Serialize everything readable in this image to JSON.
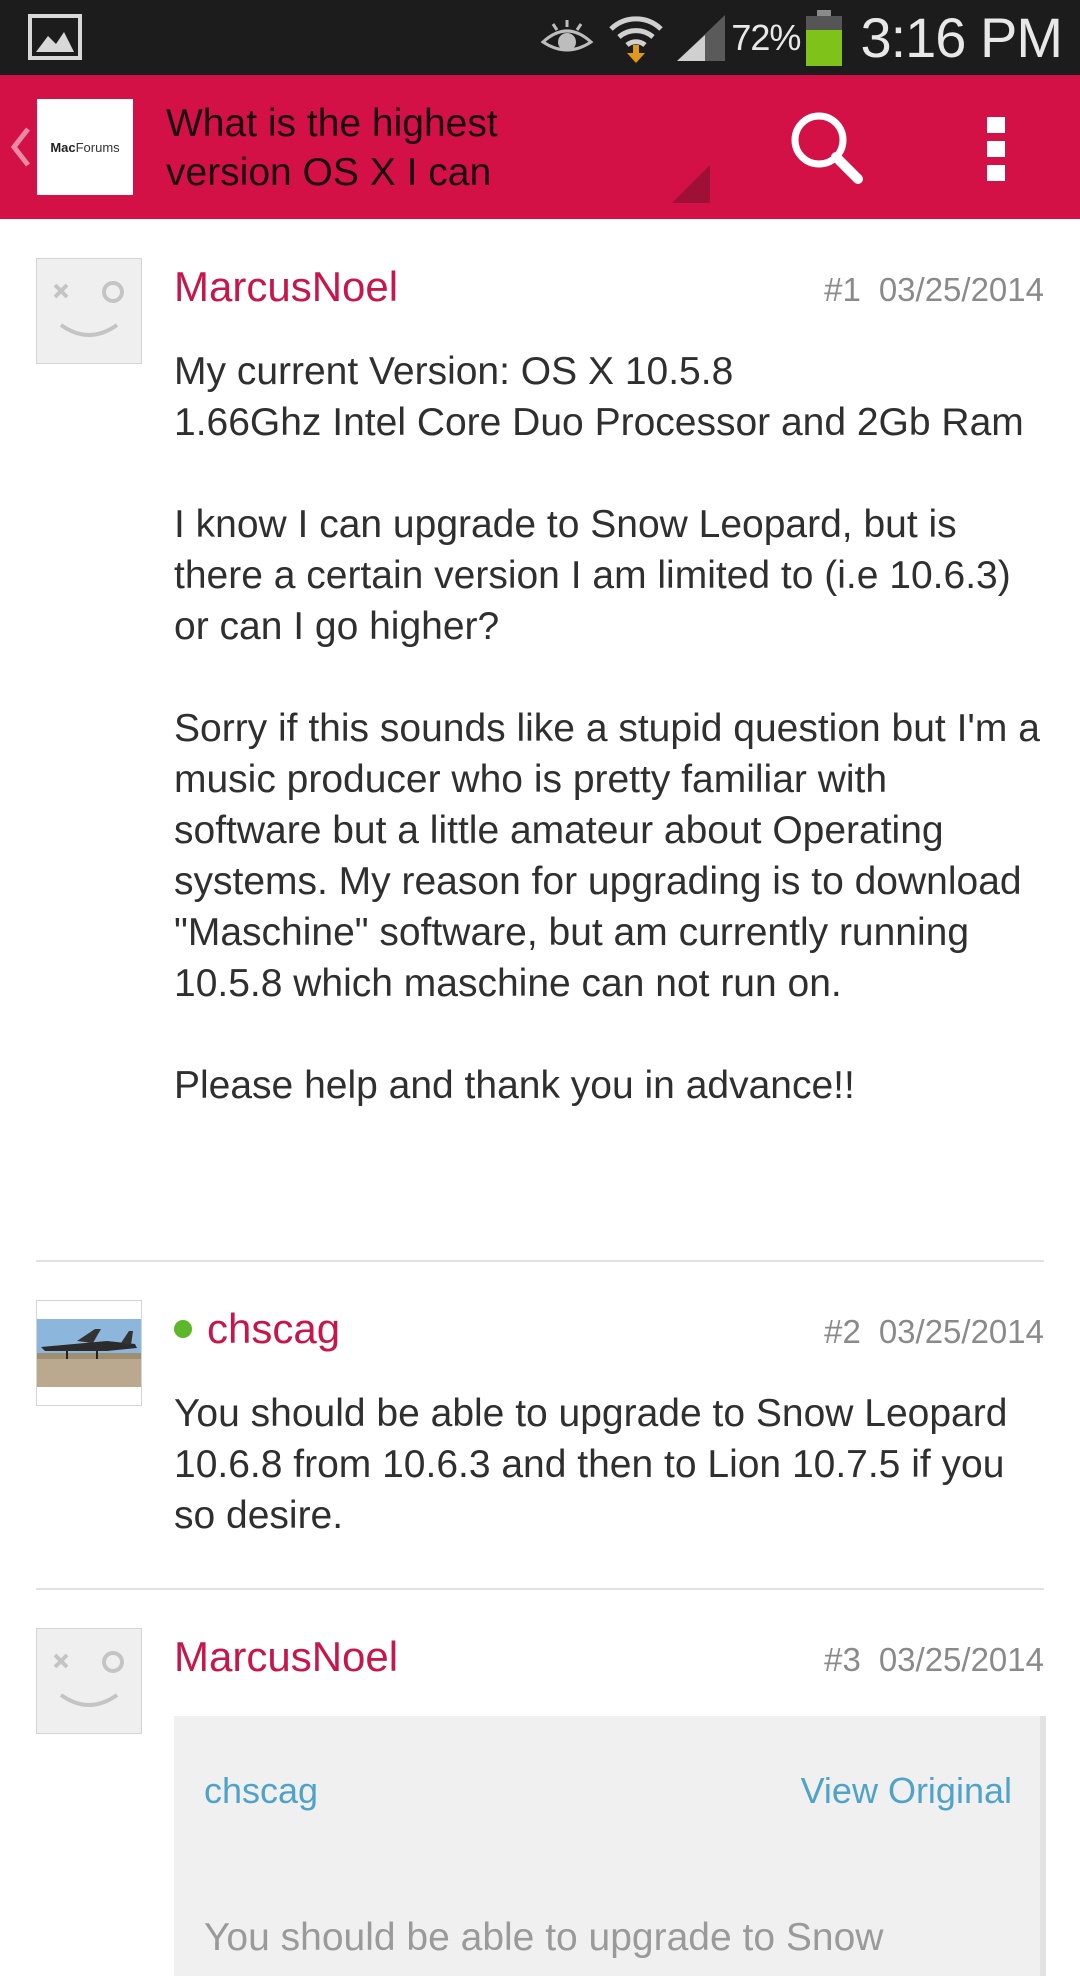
{
  "status_bar": {
    "battery_percent": "72%",
    "battery_level": 0.72,
    "time": "3:16 PM",
    "icons": [
      "gallery-icon",
      "eye-icon",
      "wifi-download-icon",
      "signal-icon",
      "battery-icon"
    ]
  },
  "action_bar": {
    "logo_text_mac": "Mac",
    "logo_text_forums": "Forums",
    "title": "What is the highest version OS X I can",
    "icons": [
      "back-chevron-icon",
      "search-icon",
      "overflow-menu-icon"
    ]
  },
  "colors": {
    "action_bar": "#d31146",
    "username": "#c7174a",
    "online": "#5cb82a",
    "quote_link": "#4fa3c9"
  },
  "posts": [
    {
      "username": "MarcusNoel",
      "number": "#1",
      "date": "03/25/2014",
      "online": false,
      "avatar": "default-face",
      "paragraphs": [
        "My current Version: OS X 10.5.8\n1.66Ghz Intel Core Duo Processor and 2Gb Ram",
        "I know I can upgrade to Snow Leopard, but is there a certain version I am limited to (i.e 10.6.3) or can I go higher?",
        "Sorry if this sounds like a stupid question but I'm a music producer who is pretty familiar with software but a little amateur about Operating systems. My reason for upgrading is to download \"Maschine\" software, but am currently running 10.5.8 which maschine can not run on.",
        "Please help and thank you in advance!!"
      ]
    },
    {
      "username": "chscag",
      "number": "#2",
      "date": "03/25/2014",
      "online": true,
      "avatar": "airplane-photo",
      "paragraphs": [
        "You should be able to upgrade to Snow Leopard 10.6.8 from 10.6.3 and then to Lion 10.7.5 if you so desire."
      ]
    },
    {
      "username": "MarcusNoel",
      "number": "#3",
      "date": "03/25/2014",
      "online": false,
      "avatar": "default-face",
      "quote": {
        "user": "chscag",
        "view_label": "View Original",
        "text": "You should be able to upgrade to Snow"
      }
    }
  ]
}
